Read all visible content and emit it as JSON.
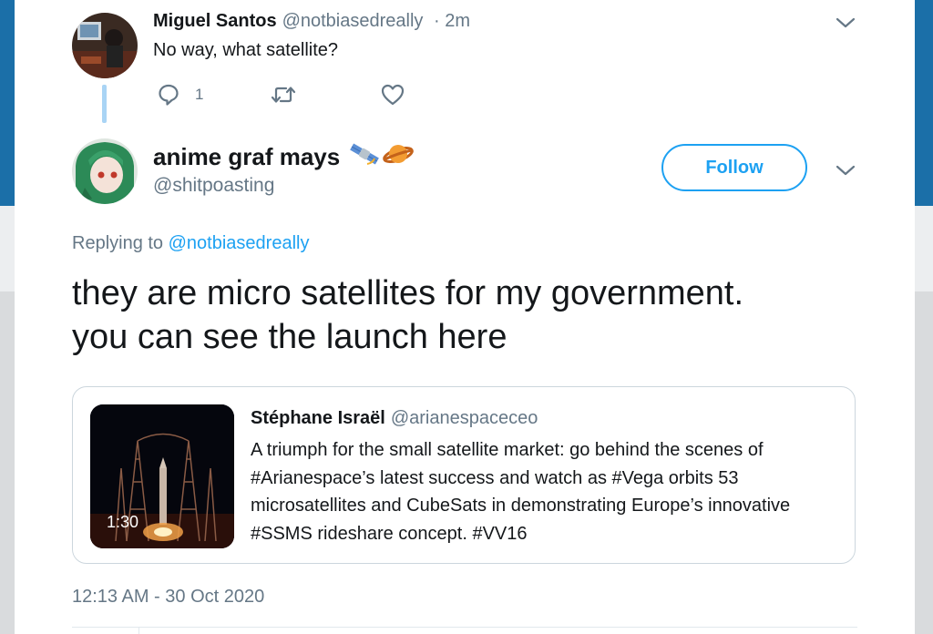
{
  "parent_tweet": {
    "name": "Miguel Santos",
    "handle": "@notbiasedreally",
    "time": "· 2m",
    "text": "No way, what satellite?",
    "reply_count": "1"
  },
  "main_tweet": {
    "name": "anime graf mays",
    "name_emojis": [
      "satellite",
      "ringed-planet"
    ],
    "handle": "@shitpoasting",
    "follow_label": "Follow",
    "replying_prefix": "Replying to",
    "replying_to": "@notbiasedreally",
    "text_line1": "they are micro satellites for my government.",
    "text_line2": "you can see the launch here",
    "timestamp": "12:13 AM - 30 Oct 2020"
  },
  "quoted_tweet": {
    "name": "Stéphane Israël",
    "handle": "@arianespaceceo",
    "video_duration": "1:30",
    "text_lines": [
      "A triumph for the small satellite market: go behind the scenes of",
      "#Arianespace’s latest success and watch as #Vega orbits 53",
      "microsatellites and CubeSats in demonstrating Europe’s innovative",
      "#SSMS rideshare concept. #VV16"
    ]
  },
  "colors": {
    "accent": "#1da1f2",
    "text": "#14171a",
    "secondary": "#657786",
    "thread_line": "#a9d4f5"
  },
  "icons": [
    "reply-icon",
    "retweet-icon",
    "heart-icon",
    "chevron-down-icon"
  ]
}
